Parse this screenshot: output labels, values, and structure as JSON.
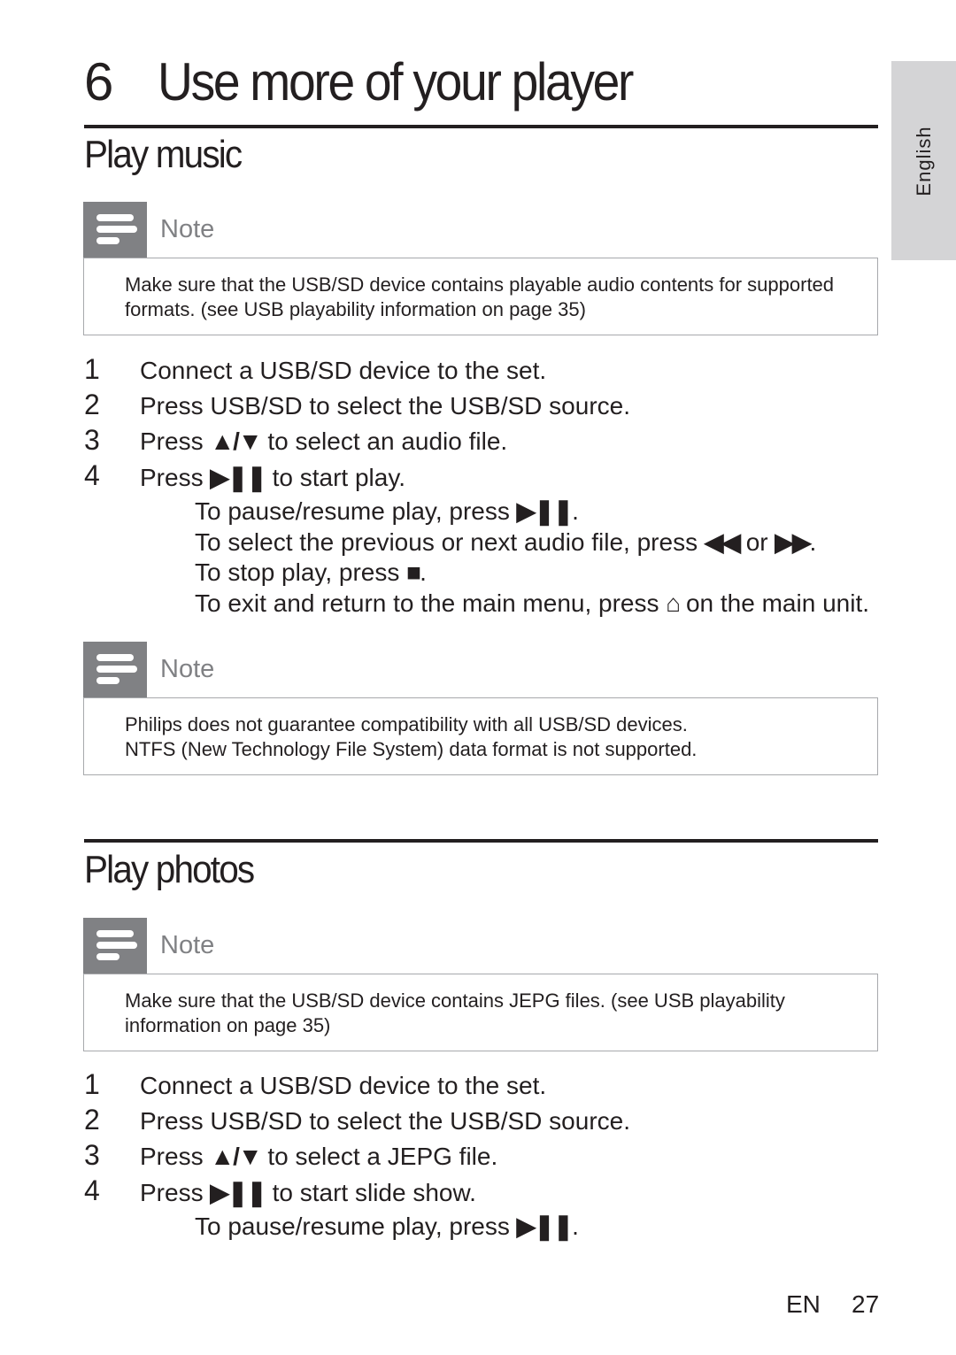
{
  "page": {
    "chapter_number": "6",
    "chapter_title": "Use more of your player",
    "language_tab": "English",
    "footer": {
      "lang": "EN",
      "page_number": "27"
    }
  },
  "icons": {
    "up_down": "▲/▼",
    "play_pause": "▶❚❚",
    "prev": "◀◀",
    "next": "▶▶",
    "stop": "■",
    "home": "⌂"
  },
  "play_music": {
    "title": "Play music",
    "note1": {
      "label": "Note",
      "lines": [
        "Make sure that the USB/SD device contains playable audio contents for supported",
        "formats. (see  USB playability information  on page 35)"
      ]
    },
    "steps": [
      {
        "num": "1",
        "parts": [
          "Connect a USB/SD device to the set."
        ]
      },
      {
        "num": "2",
        "parts": [
          "Press ",
          "USB/SD",
          " to select the USB/SD source."
        ]
      },
      {
        "num": "3",
        "parts": [
          "Press ",
          "▲/▼",
          " to select an audio file."
        ]
      },
      {
        "num": "4",
        "parts": [
          "Press ",
          "▶❚❚",
          " to start play."
        ]
      }
    ],
    "subs": [
      {
        "before": "To pause/resume play, press ",
        "sym": "▶❚❚",
        "after": "."
      },
      {
        "before": "To select the previous or next audio file, press ",
        "sym": "◀◀",
        "mid": " or ",
        "sym2": "▶▶",
        "after": "."
      },
      {
        "before": "To stop play, press ",
        "sym": "■",
        "after": "."
      },
      {
        "before": "To exit and return to the main menu, press ",
        "sym": "⌂",
        "after": " on the main unit."
      }
    ],
    "note2": {
      "label": "Note",
      "lines": [
        "Philips does not guarantee compatibility with all USB/SD devices.",
        "NTFS (New Technology File System) data format is not supported."
      ]
    }
  },
  "play_photos": {
    "title": "Play photos",
    "note": {
      "label": "Note",
      "lines": [
        "Make sure that the USB/SD device contains JEPG files. (see  USB playability",
        "information  on page 35)"
      ]
    },
    "steps": [
      {
        "num": "1",
        "parts": [
          "Connect a USB/SD device to the set."
        ]
      },
      {
        "num": "2",
        "parts": [
          "Press ",
          "USB/SD",
          " to select the USB/SD source."
        ]
      },
      {
        "num": "3",
        "parts": [
          "Press ",
          "▲/▼",
          " to select a JEPG file."
        ]
      },
      {
        "num": "4",
        "parts": [
          "Press ",
          "▶❚❚",
          " to start slide show."
        ]
      }
    ],
    "subs": [
      {
        "before": "To pause/resume play, press ",
        "sym": "▶❚❚",
        "after": "."
      }
    ]
  }
}
